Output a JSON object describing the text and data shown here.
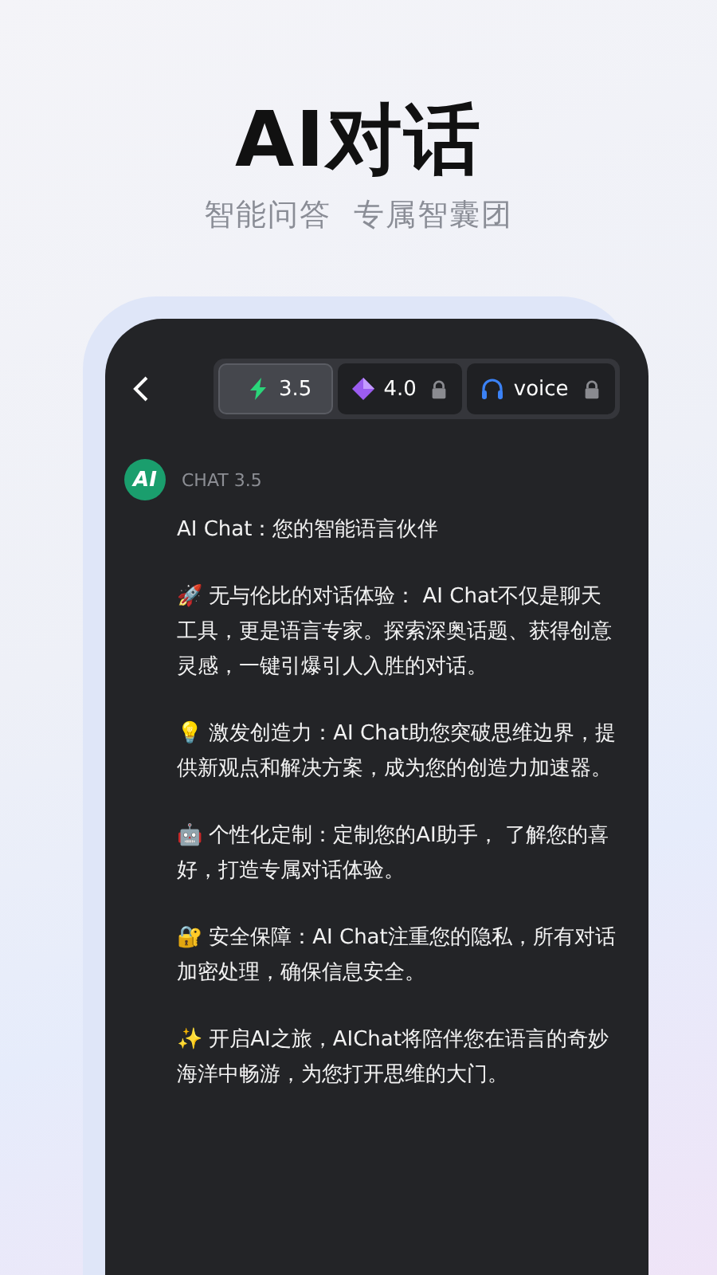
{
  "hero": {
    "title": "AI对话",
    "subtitle": "智能问答  专属智囊团"
  },
  "model_tabs": [
    {
      "label": "3.5",
      "kind": "bolt",
      "selected": true,
      "locked": false
    },
    {
      "label": "4.0",
      "kind": "gem",
      "selected": false,
      "locked": true
    },
    {
      "label": "voice",
      "kind": "headphones",
      "selected": false,
      "locked": true
    }
  ],
  "message": {
    "avatar": "AI",
    "sender": "CHAT  3.5",
    "paragraphs": [
      "AI Chat：您的智能语言伙伴",
      "🚀 无与伦比的对话体验： AI Chat不仅是聊天工具，更是语言专家。探索深奥话题、获得创意灵感，一键引爆引人入胜的对话。",
      "💡 激发创造力：AI Chat助您突破思维边界，提供新观点和解决方案，成为您的创造力加速器。",
      "🤖 个性化定制：定制您的AI助手， 了解您的喜好，打造专属对话体验。",
      "🔐 安全保障：AI Chat注重您的隐私，所有对话加密处理，确保信息安全。",
      "✨ 开启AI之旅，AIChat将陪伴您在语言的奇妙海洋中畅游，为您打开思维的大门。"
    ]
  }
}
